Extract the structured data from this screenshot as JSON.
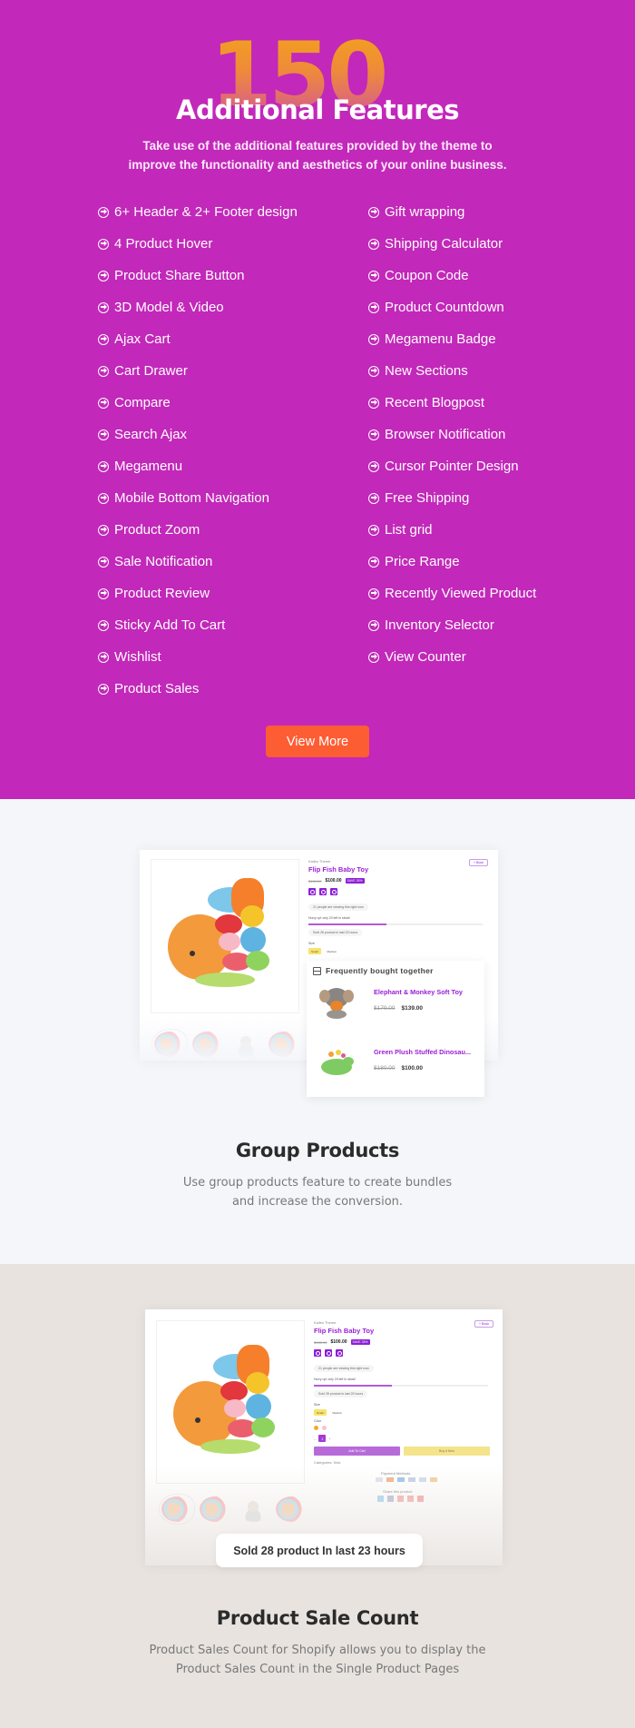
{
  "features": {
    "big_number": "150",
    "big_number_suffix": "+",
    "title": "Additional Features",
    "subtitle": "Take use of the additional features provided by the theme to improve the functionality and aesthetics of your online business.",
    "left_column": [
      "6+ Header & 2+ Footer design",
      "4 Product Hover",
      "Product Share Button",
      "3D Model & Video",
      "Ajax Cart",
      "Cart Drawer",
      "Compare",
      "Search Ajax",
      "Megamenu",
      "Mobile Bottom Navigation",
      "Product Zoom",
      "Sale Notification",
      "Product Review",
      "Sticky Add To Cart",
      "Wishlist",
      "Product Sales"
    ],
    "right_column": [
      " Gift wrapping",
      "Shipping Calculator",
      "Coupon Code",
      "Product Countdown",
      "Megamenu Badge",
      "New Sections",
      "Recent Blogpost",
      "Browser Notification",
      "Cursor Pointer Design",
      "Free Shipping",
      "List grid",
      "Price Range",
      "Recently Viewed Product",
      "Inventory Selector",
      "View Counter"
    ],
    "item_icon": "circle-arrow-right-icon",
    "view_more_label": "View More",
    "colors": {
      "background": "#c228b9",
      "button": "#fd5d33",
      "number_gradient_top": "#f3a21c",
      "number_gradient_bottom": "#d4559a"
    }
  },
  "group_products": {
    "mockup": {
      "vendor": "Kalles Theme",
      "product_title": "Flip Fish Baby Toy",
      "old_price": "$150.00",
      "price": "$100.00",
      "sale_badge": "SAVE 33%",
      "viewing_text": "21 people are viewing this right now",
      "stock_text": "Hurry up! only 20 left in stock!",
      "stock_progress": 0.45,
      "sold_text": "Sold 28 product in last 23 hours",
      "size_label": "Size",
      "sizes": [
        "Small",
        "Medium"
      ],
      "compare_label": "+ Book"
    },
    "frequently_bought": {
      "heading": "Frequently bought together",
      "items": [
        {
          "name": "Elephant & Monkey Soft Toy",
          "old_price": "$179.00",
          "price": "$139.00"
        },
        {
          "name": "Green Plush Stuffed Dinosau...",
          "old_price": "$180.00",
          "price": "$100.00"
        }
      ]
    },
    "title": "Group Products",
    "description": "Use group products feature to create bundles and increase the conversion.",
    "background": "#f5f6fa"
  },
  "product_sale_count": {
    "mockup": {
      "vendor": "Kalles Theme",
      "product_title": "Flip Fish Baby Toy",
      "old_price": "$150.00",
      "price": "$100.00",
      "sale_badge": "SAVE 33%",
      "viewing_text": "21 people are viewing this right now",
      "stock_text": "Hurry up! only 20 left in stock!",
      "stock_progress": 0.45,
      "sold_text": "Sold 28 product in last 23 hours",
      "size_label": "Size",
      "sizes": [
        "Small",
        "Medium"
      ],
      "color_label": "Color",
      "quantity": "1",
      "add_to_cart": "Add To Cart",
      "buy_now": "Buy it Now",
      "categories": "Categories: Kids",
      "payment_label": "Payment Methods",
      "share_label": "Share this product",
      "compare_label": "+ Book"
    },
    "sold_badge": "Sold 28 product In last 23 hours",
    "title": "Product Sale Count",
    "description": "Product Sales Count for Shopify allows you to display the Product Sales Count in the  Single Product Pages",
    "background": "#e8e3df"
  }
}
